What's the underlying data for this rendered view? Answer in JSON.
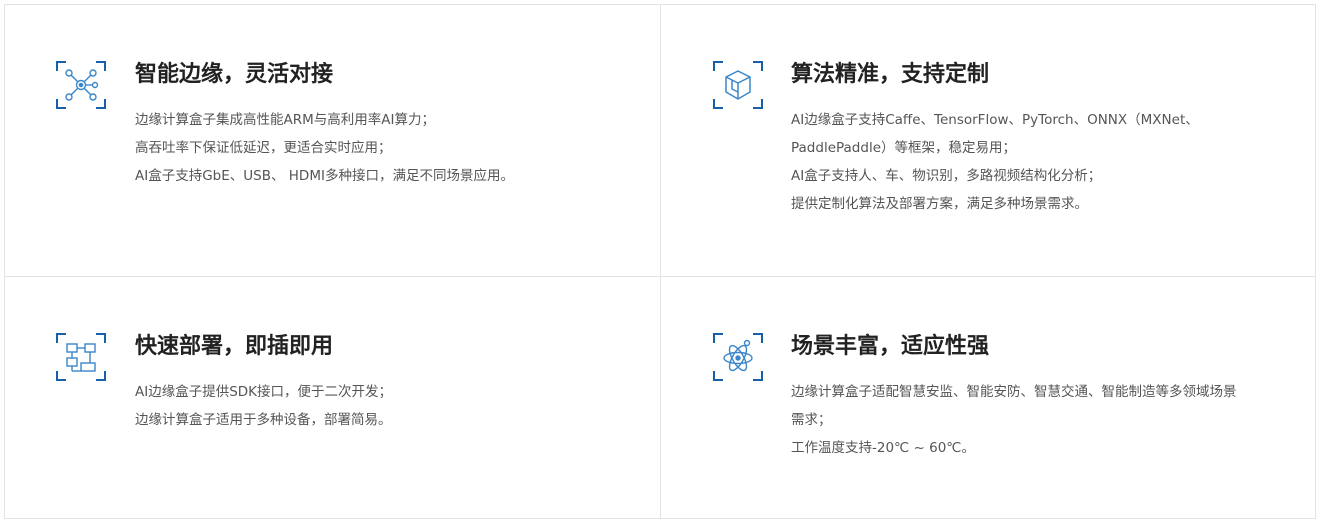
{
  "colors": {
    "accent_blue": "#1a5fa8",
    "border": "#e3e3e3",
    "title": "#222222",
    "text": "#555555"
  },
  "features": [
    {
      "icon": "network-node-icon",
      "title": "智能边缘，灵活对接",
      "lines": [
        "边缘计算盒子集成高性能ARM与高利用率AI算力；",
        "高吞吐率下保证低延迟，更适合实时应用；",
        "AI盒子支持GbE、USB、 HDMI多种接口，满足不同场景应用。"
      ]
    },
    {
      "icon": "cube-icon",
      "title": "算法精准，支持定制",
      "lines": [
        "AI边缘盒子支持Caffe、TensorFlow、PyTorch、ONNX（MXNet、",
        "PaddlePaddle）等框架，稳定易用；",
        "AI盒子支持人、车、物识别，多路视频结构化分析；",
        "提供定制化算法及部署方案，满足多种场景需求。"
      ]
    },
    {
      "icon": "flowchart-icon",
      "title": "快速部署，即插即用",
      "lines": [
        "AI边缘盒子提供SDK接口，便于二次开发；",
        "边缘计算盒子适用于多种设备，部署简易。"
      ]
    },
    {
      "icon": "atom-icon",
      "title": "场景丰富，适应性强",
      "lines": [
        "边缘计算盒子适配智慧安监、智能安防、智慧交通、智能制造等多领域场景",
        "需求；",
        "工作温度支持-20℃ ~ 60℃。"
      ]
    }
  ]
}
